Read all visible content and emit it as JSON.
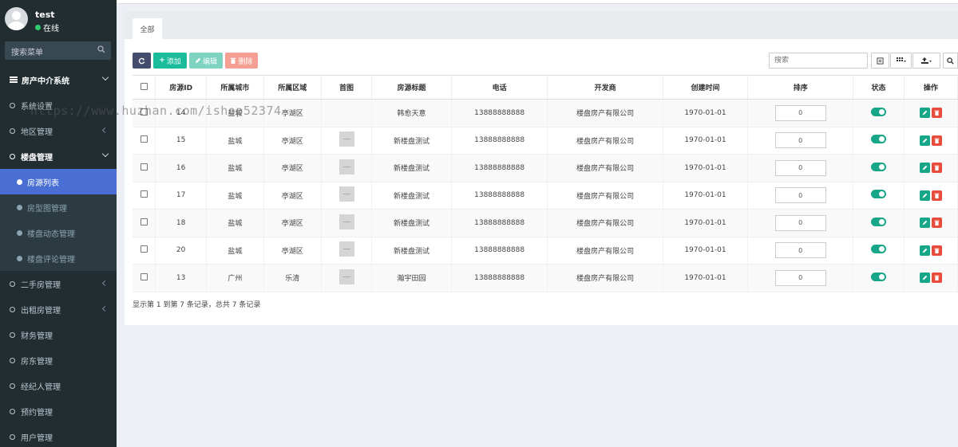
{
  "user": {
    "name": "test",
    "status": "在线"
  },
  "search_menu": {
    "placeholder": "搜索菜单"
  },
  "menu": {
    "system": "房产中介系统",
    "items_top": [
      "系统设置",
      "地区管理"
    ],
    "group": "楼盘管理",
    "sub_items": [
      "房源列表",
      "房型图管理",
      "楼盘动态管理",
      "楼盘评论管理"
    ],
    "items_bottom": [
      "二手房管理",
      "出租房管理",
      "财务管理",
      "房东管理",
      "经纪人管理",
      "预约管理",
      "用户管理"
    ]
  },
  "tabs": {
    "all": "全部"
  },
  "toolbar": {
    "add": "添加",
    "edit": "编辑",
    "delete": "删除",
    "search_placeholder": "搜索"
  },
  "table": {
    "headers": [
      "房源ID",
      "所属城市",
      "所属区域",
      "首图",
      "房源标题",
      "电话",
      "开发商",
      "创建时间",
      "排序",
      "状态",
      "操作"
    ],
    "rows": [
      {
        "id": "14",
        "city": "盐城",
        "area": "亭湖区",
        "title": "韩愈天意",
        "phone": "13888888888",
        "dev": "楼盘房产有限公司",
        "date": "1970-01-01",
        "sort": "0",
        "img": false
      },
      {
        "id": "15",
        "city": "盐城",
        "area": "亭湖区",
        "title": "新楼盘测试",
        "phone": "13888888888",
        "dev": "楼盘房产有限公司",
        "date": "1970-01-01",
        "sort": "0",
        "img": true
      },
      {
        "id": "16",
        "city": "盐城",
        "area": "亭湖区",
        "title": "新楼盘测试",
        "phone": "13888888888",
        "dev": "楼盘房产有限公司",
        "date": "1970-01-01",
        "sort": "0",
        "img": true
      },
      {
        "id": "17",
        "city": "盐城",
        "area": "亭湖区",
        "title": "新楼盘测试",
        "phone": "13888888888",
        "dev": "楼盘房产有限公司",
        "date": "1970-01-01",
        "sort": "0",
        "img": true
      },
      {
        "id": "18",
        "city": "盐城",
        "area": "亭湖区",
        "title": "新楼盘测试",
        "phone": "13888888888",
        "dev": "楼盘房产有限公司",
        "date": "1970-01-01",
        "sort": "0",
        "img": true
      },
      {
        "id": "20",
        "city": "盐城",
        "area": "亭湖区",
        "title": "新楼盘测试",
        "phone": "13888888888",
        "dev": "楼盘房产有限公司",
        "date": "1970-01-01",
        "sort": "0",
        "img": true
      },
      {
        "id": "13",
        "city": "广州",
        "area": "乐清",
        "title": "瀚宇田园",
        "phone": "13888888888",
        "dev": "楼盘房产有限公司",
        "date": "1970-01-01",
        "sort": "0",
        "img": true
      }
    ]
  },
  "footer": {
    "summary": "显示第 1 到第 7 条记录，总共 7 条记录"
  },
  "watermark": "https://www.huzhan.com/ishop52374"
}
